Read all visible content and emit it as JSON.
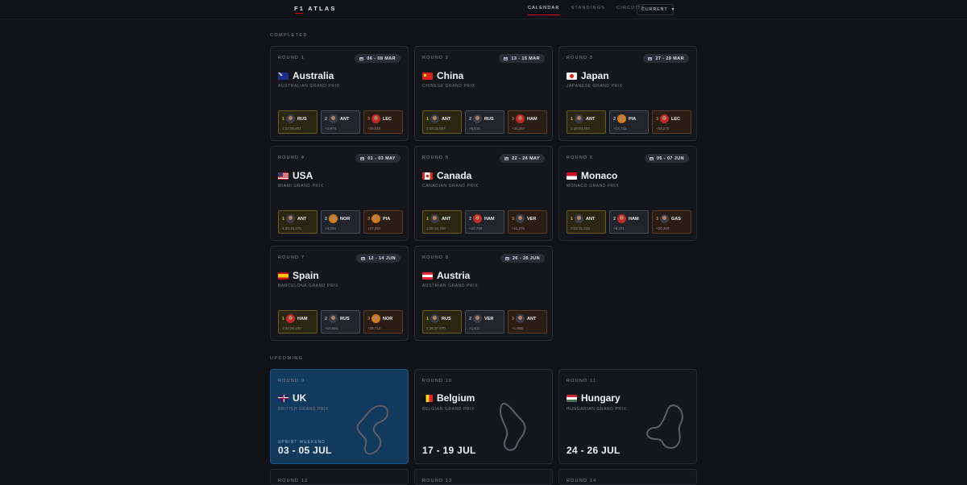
{
  "app": {
    "brand": "F1 ATLAS"
  },
  "nav": {
    "items": [
      "CALENDAR",
      "STANDINGS",
      "CIRCUITS"
    ],
    "active": "CALENDAR"
  },
  "season_select": {
    "value": "CURRENT"
  },
  "sections": {
    "completed": "COMPLETED",
    "upcoming": "UPCOMING"
  },
  "completed": [
    {
      "round": "ROUND 1",
      "dates": "06 - 08 MAR",
      "country": "Australia",
      "gp": "AUSTRALIAN GRAND PRIX",
      "podium": [
        {
          "pos": "1",
          "code": "RUS",
          "time": "1:23:06,801"
        },
        {
          "pos": "2",
          "code": "ANT",
          "time": "+2,974"
        },
        {
          "pos": "3",
          "code": "LEC",
          "time": "+15,519"
        }
      ]
    },
    {
      "round": "ROUND 2",
      "dates": "13 - 15 MAR",
      "country": "China",
      "gp": "CHINESE GRAND PRIX",
      "podium": [
        {
          "pos": "1",
          "code": "ANT",
          "time": "1:33:15,607"
        },
        {
          "pos": "2",
          "code": "RUS",
          "time": "+5,515"
        },
        {
          "pos": "3",
          "code": "HAM",
          "time": "+25,267"
        }
      ]
    },
    {
      "round": "ROUND 3",
      "dates": "27 - 29 MAR",
      "country": "Japan",
      "gp": "JAPANESE GRAND PRIX",
      "podium": [
        {
          "pos": "1",
          "code": "ANT",
          "time": "1:28:03,403"
        },
        {
          "pos": "2",
          "code": "PIA",
          "time": "+13,722"
        },
        {
          "pos": "3",
          "code": "LEC",
          "time": "+15,270"
        }
      ]
    },
    {
      "round": "ROUND 4",
      "dates": "01 - 03 MAY",
      "country": "USA",
      "gp": "MIAMI GRAND PRIX",
      "podium": [
        {
          "pos": "1",
          "code": "ANT",
          "time": "1:33:19,275"
        },
        {
          "pos": "2",
          "code": "NOR",
          "time": "+3,264"
        },
        {
          "pos": "3",
          "code": "PIA",
          "time": "+27,092"
        }
      ]
    },
    {
      "round": "ROUND 5",
      "dates": "22 - 24 MAY",
      "country": "Canada",
      "gp": "CANADIAN GRAND PRIX",
      "podium": [
        {
          "pos": "1",
          "code": "ANT",
          "time": "1:28:15,758"
        },
        {
          "pos": "2",
          "code": "HAM",
          "time": "+10,768"
        },
        {
          "pos": "3",
          "code": "VER",
          "time": "+11,276"
        }
      ]
    },
    {
      "round": "ROUND 6",
      "dates": "05 - 07 JUN",
      "country": "Monaco",
      "gp": "MONACO GRAND PRIX",
      "podium": [
        {
          "pos": "1",
          "code": "ANT",
          "time": "2:23:31,243"
        },
        {
          "pos": "2",
          "code": "HAM",
          "time": "+8,271"
        },
        {
          "pos": "3",
          "code": "GAS",
          "time": "+20,359"
        }
      ]
    },
    {
      "round": "ROUND 7",
      "dates": "12 - 14 JUN",
      "country": "Spain",
      "gp": "BARCELONA GRAND PRIX",
      "podium": [
        {
          "pos": "1",
          "code": "HAM",
          "time": "1:32:26,105"
        },
        {
          "pos": "2",
          "code": "RUS",
          "time": "+10,551"
        },
        {
          "pos": "3",
          "code": "NOR",
          "time": "+25,710"
        }
      ]
    },
    {
      "round": "ROUND 8",
      "dates": "26 - 28 JUN",
      "country": "Austria",
      "gp": "AUSTRIAN GRAND PRIX",
      "podium": [
        {
          "pos": "1",
          "code": "RUS",
          "time": "1:26:37,970"
        },
        {
          "pos": "2",
          "code": "VER",
          "time": "+1,611"
        },
        {
          "pos": "3",
          "code": "ANT",
          "time": "+1,955"
        }
      ]
    }
  ],
  "upcoming": [
    {
      "round": "ROUND 9",
      "country": "UK",
      "gp": "BRITISH GRAND PRIX",
      "sprint": "SPRINT WEEKEND",
      "dates": "03 - 05 JUL"
    },
    {
      "round": "ROUND 10",
      "country": "Belgium",
      "gp": "BELGIAN GRAND PRIX",
      "dates": "17 - 19 JUL"
    },
    {
      "round": "ROUND 11",
      "country": "Hungary",
      "gp": "HUNGARIAN GRAND PRIX",
      "dates": "24 - 26 JUL"
    },
    {
      "round": "ROUND 12"
    },
    {
      "round": "ROUND 13"
    },
    {
      "round": "ROUND 14"
    }
  ],
  "colors": {
    "accent": "#e10600",
    "p1": "#d4b63a",
    "p2": "#b9bcc6",
    "p3": "#c78046",
    "next_card": "#113a5c"
  }
}
